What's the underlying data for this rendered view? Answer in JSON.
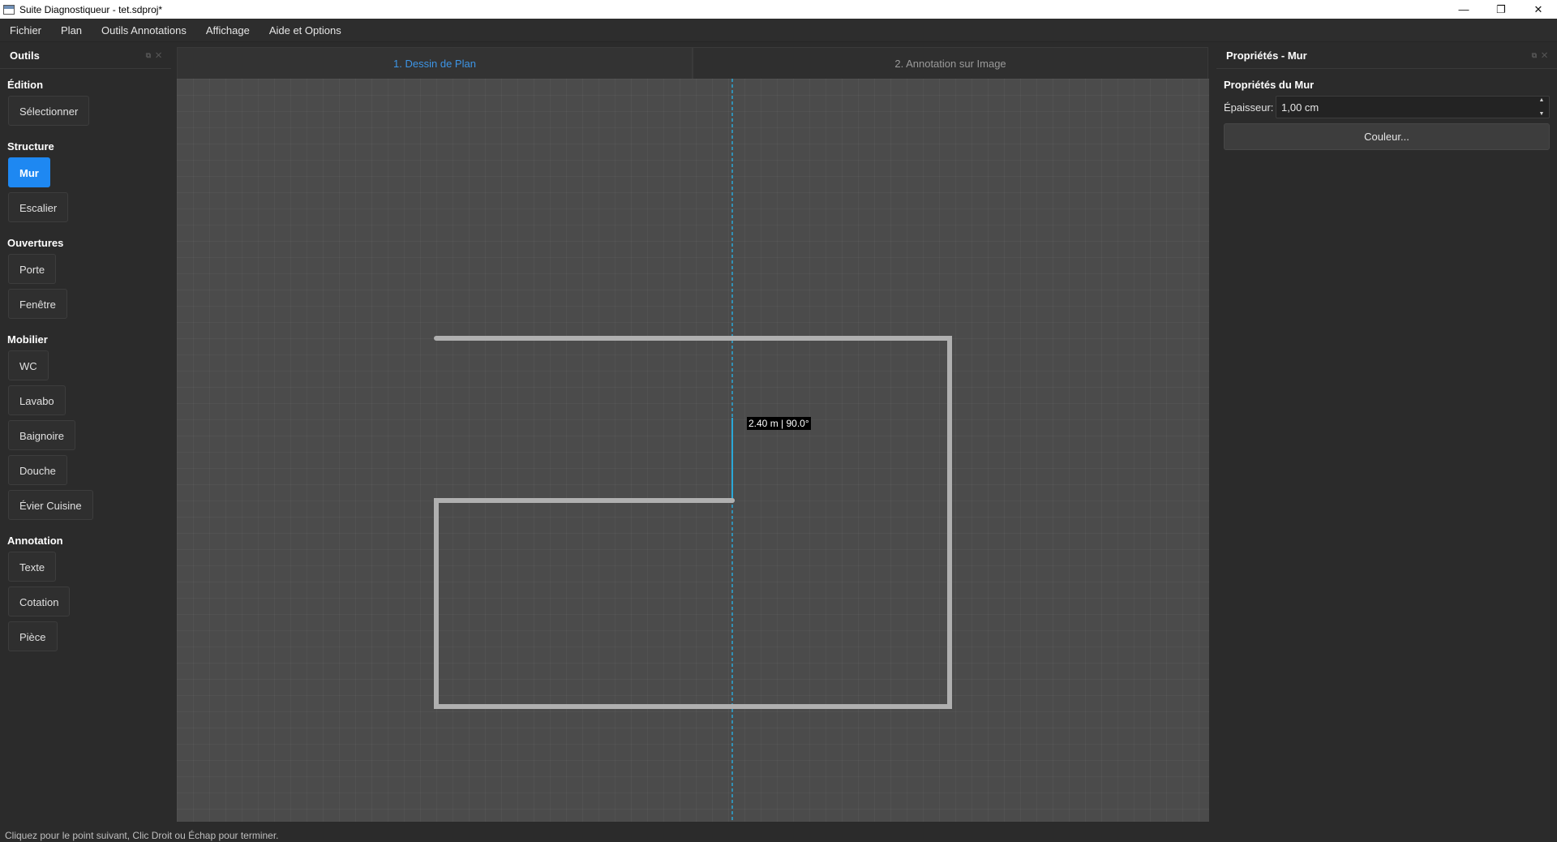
{
  "window": {
    "title": "Suite Diagnostiqueur - tet.sdproj*",
    "minimize": "—",
    "maximize": "❐",
    "close": "✕"
  },
  "menu": [
    "Fichier",
    "Plan",
    "Outils Annotations",
    "Affichage",
    "Aide et Options"
  ],
  "tools_panel": {
    "title": "Outils",
    "sections": {
      "edition": {
        "title": "Édition",
        "items": [
          "Sélectionner"
        ]
      },
      "structure": {
        "title": "Structure",
        "items": [
          "Mur",
          "Escalier"
        ]
      },
      "ouvertures": {
        "title": "Ouvertures",
        "items": [
          "Porte",
          "Fenêtre"
        ]
      },
      "mobilier": {
        "title": "Mobilier",
        "items": [
          "WC",
          "Lavabo",
          "Baignoire",
          "Douche",
          "Évier Cuisine"
        ]
      },
      "annotation": {
        "title": "Annotation",
        "items": [
          "Texte",
          "Cotation",
          "Pièce"
        ]
      }
    },
    "active_tool": "Mur"
  },
  "tabs": [
    {
      "label": "1. Dessin de Plan",
      "active": true
    },
    {
      "label": "2. Annotation sur Image",
      "active": false
    }
  ],
  "canvas": {
    "measure_label": "2.40 m | 90.0°"
  },
  "properties_panel": {
    "title": "Propriétés - Mur",
    "section_title": "Propriétés du Mur",
    "thickness_label": "Épaisseur:",
    "thickness_value": "1,00 cm",
    "color_button": "Couleur..."
  },
  "status": "Cliquez pour le point suivant, Clic Droit ou Échap pour terminer.",
  "colors": {
    "accent": "#1e88f2",
    "tab_active_text": "#3d95e6",
    "guide_line": "#2aa8d8",
    "wall": "#b0b0b0"
  }
}
